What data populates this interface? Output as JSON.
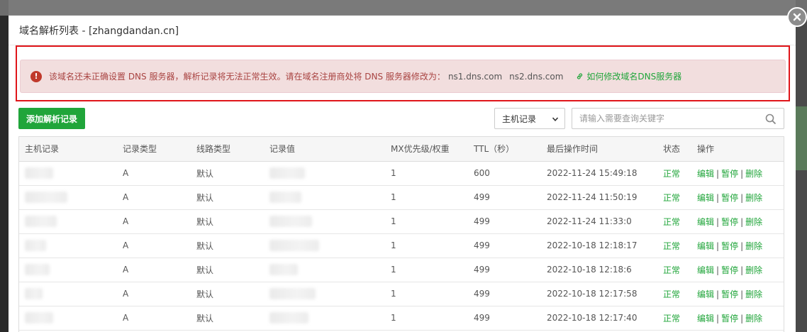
{
  "modal": {
    "title": "域名解析列表 - [zhangdandan.cn]"
  },
  "alert": {
    "message": "该域名还未正确设置 DNS 服务器，解析记录将无法正常生效。请在域名注册商处将 DNS 服务器修改为：",
    "ns1": "ns1.dns.com",
    "ns2": "ns2.dns.com",
    "help_link": "如何修改域名DNS服务器"
  },
  "toolbar": {
    "add_label": "添加解析记录",
    "select_value": "主机记录",
    "search_placeholder": "请输入需要查询关键字"
  },
  "table": {
    "headers": [
      "主机记录",
      "记录类型",
      "线路类型",
      "记录值",
      "MX优先级/权重",
      "TTL（秒）",
      "最后操作时间",
      "状态",
      "操作"
    ],
    "rows": [
      {
        "type": "A",
        "line": "默认",
        "mx": "1",
        "ttl": "600",
        "time": "2022-11-24 15:49:18",
        "status": "正常"
      },
      {
        "type": "A",
        "line": "默认",
        "mx": "1",
        "ttl": "499",
        "time": "2022-11-24 11:50:19",
        "status": "正常"
      },
      {
        "type": "A",
        "line": "默认",
        "mx": "1",
        "ttl": "499",
        "time": "2022-11-24 11:33:0",
        "status": "正常"
      },
      {
        "type": "A",
        "line": "默认",
        "mx": "1",
        "ttl": "499",
        "time": "2022-10-18 12:18:17",
        "status": "正常"
      },
      {
        "type": "A",
        "line": "默认",
        "mx": "1",
        "ttl": "499",
        "time": "2022-10-18 12:18:6",
        "status": "正常"
      },
      {
        "type": "A",
        "line": "默认",
        "mx": "1",
        "ttl": "499",
        "time": "2022-10-18 12:17:58",
        "status": "正常"
      },
      {
        "type": "A",
        "line": "默认",
        "mx": "1",
        "ttl": "499",
        "time": "2022-10-18 12:17:40",
        "status": "正常"
      }
    ],
    "actions": {
      "edit": "编辑",
      "pause": "暂停",
      "delete": "删除",
      "separator": "|"
    }
  },
  "colors": {
    "accent": "#20a53a",
    "alert_bg": "#f2dede",
    "alert_text": "#a94442",
    "highlight_border": "#e0151a"
  },
  "icons": {
    "close": "close-icon",
    "warning": "warning-icon",
    "link": "link-icon",
    "search": "search-icon",
    "chevron": "chevron-down-icon"
  }
}
